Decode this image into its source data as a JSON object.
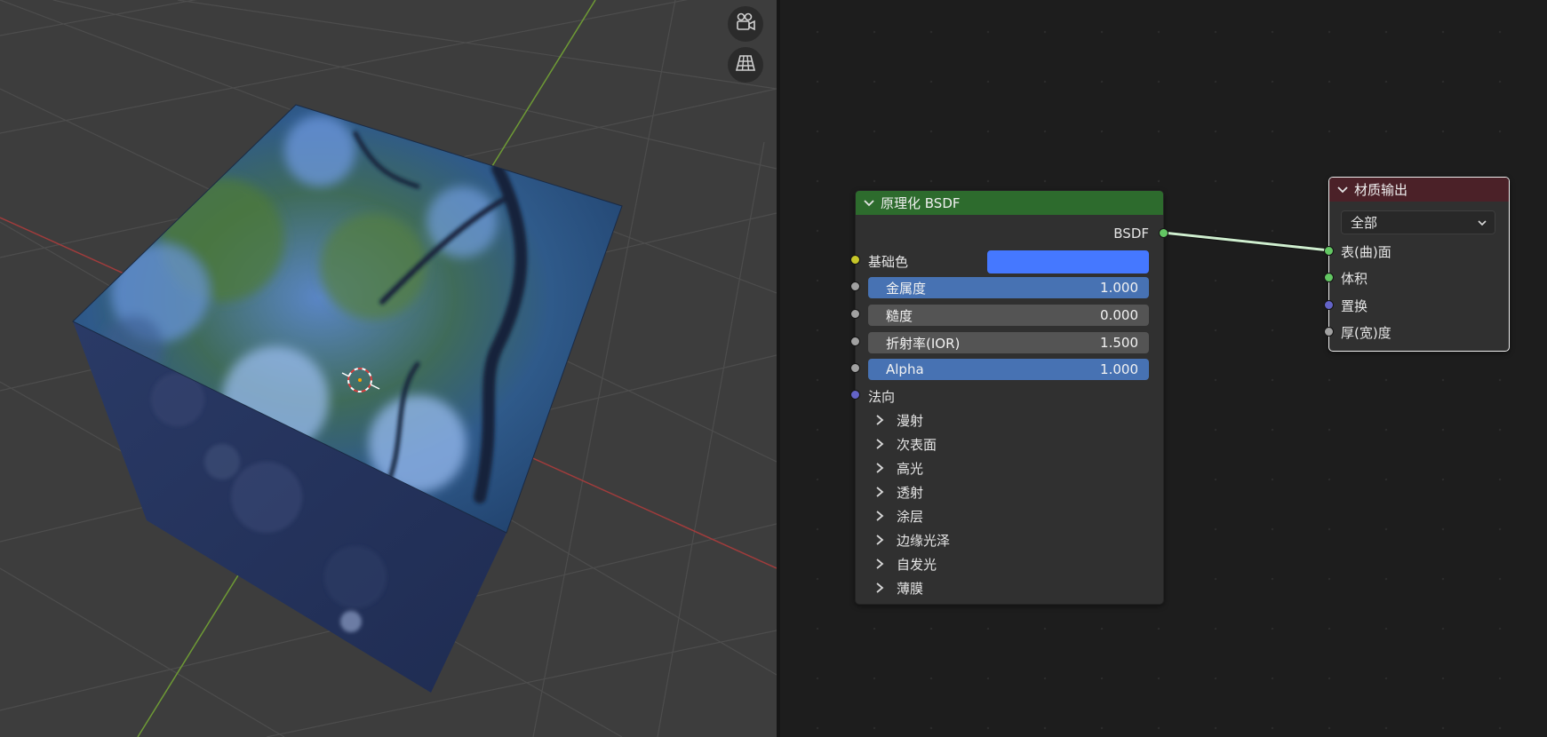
{
  "viewport": {
    "gizmo_buttons": [
      {
        "icon": "camera-icon"
      },
      {
        "icon": "perspective-grid-icon"
      }
    ]
  },
  "principled_node": {
    "title": "原理化 BSDF",
    "header_color": "#2d6b2d",
    "output_label": "BSDF",
    "base_color_label": "基础色",
    "base_color_value": "#4578ff",
    "fields": [
      {
        "label": "金属度",
        "value": "1.000",
        "style": "blue"
      },
      {
        "label": "糙度",
        "value": "0.000",
        "style": "grey"
      },
      {
        "label": "折射率(IOR)",
        "value": "1.500",
        "style": "grey"
      },
      {
        "label": "Alpha",
        "value": "1.000",
        "style": "blue"
      }
    ],
    "normal_label": "法向",
    "panels": [
      "漫射",
      "次表面",
      "高光",
      "透射",
      "涂层",
      "边缘光泽",
      "自发光",
      "薄膜"
    ]
  },
  "output_node": {
    "title": "材质输出",
    "header_color": "#4b2128",
    "target": "全部",
    "inputs": [
      "表(曲)面",
      "体积",
      "置换",
      "厚(宽)度"
    ]
  },
  "colors": {
    "socket_shader": "#63c763",
    "socket_color": "#c7c729",
    "socket_float": "#a1a1a1",
    "socket_vector": "#6363c7",
    "link": "#cfeecf"
  }
}
